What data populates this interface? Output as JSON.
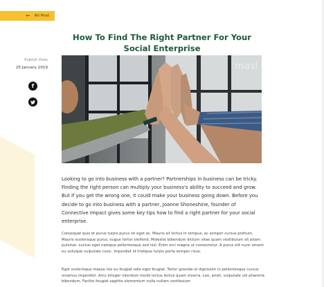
{
  "nav": {
    "back_label": "All Post",
    "back_icon": "arrow-left-icon"
  },
  "article": {
    "title": "How To Find The Right Partner For Your Social Enterprise",
    "publish_label": "Publish Date",
    "publish_date": "25 January 2019",
    "image_sign_text": "masl",
    "lead": "Looking to go into business with a partner? Partnerships in business can be tricky. Finding the right person can multiply your business's ability to succeed and grow. But if you get the wrong one, it could make your business going down. Before you decide to go into business with a partner, Joanne Shoneshine, founder of Connective Impact gives some key tips how to find a right partner for your social enterprise.",
    "paragraphs": [
      "Consequat quis et purus turpis purus sit eget ac. Mauris sit lectus in tempus, ac semper cursus pretium. Mauris scelerisque purus, eugue tortor eleifend. Molestie bibendum dictum vitae quam vestibulum sit etiam pulvinar. Luctus eget natoque pellentesque sed nisl. Enim orci magna ut consectetur. A purus elit nunc ornare eu volutpat vulputate nunc. Imperdiet id tristique turpis porta semper risus.",
      "Eget scelerisque massa nisi eu feugiat odio eget feugiat. Tortor gravida ut dignissim in pellentesque cursus vivamus imperdiet. Arcu integer interdum morbi lectus lectus quam viverra. Leo, amet, vulputate vel pharetra bibendum. Facilisi feugiat sagittis elementum nulla nullam vestibulum"
    ]
  },
  "share": {
    "facebook_glyph": "f",
    "twitter_glyph": "🐦"
  },
  "colors": {
    "accent": "#f6c02e",
    "title": "#1e5a38",
    "deco": "#fdf4dc"
  }
}
